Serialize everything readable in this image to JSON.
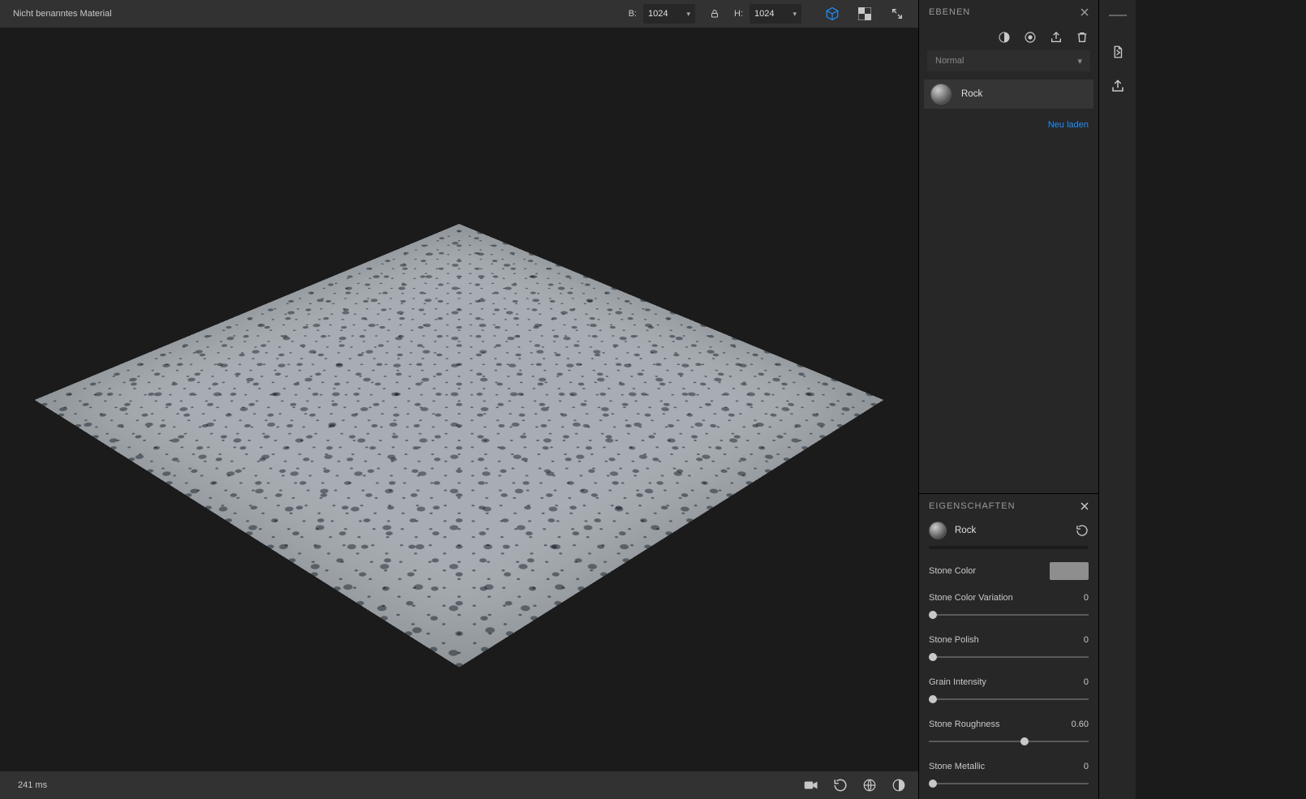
{
  "topbar": {
    "title": "Nicht benanntes Material",
    "dim_b_label": "B:",
    "dim_b_value": "1024",
    "dim_h_label": "H:",
    "dim_h_value": "1024"
  },
  "statusbar": {
    "time": "241 ms"
  },
  "layers_panel": {
    "title": "EBENEN",
    "blend_mode": "Normal",
    "layer_name": "Rock",
    "reload_label": "Neu laden"
  },
  "properties_panel": {
    "title": "EIGENSCHAFTEN",
    "material_name": "Rock",
    "props": {
      "stone_color": {
        "label": "Stone Color"
      },
      "stone_color_variation": {
        "label": "Stone Color Variation",
        "value": "0",
        "pct": 0
      },
      "stone_polish": {
        "label": "Stone Polish",
        "value": "0",
        "pct": 0
      },
      "grain_intensity": {
        "label": "Grain Intensity",
        "value": "0",
        "pct": 0
      },
      "stone_roughness": {
        "label": "Stone Roughness",
        "value": "0.60",
        "pct": 60
      },
      "stone_metallic": {
        "label": "Stone Metallic",
        "value": "0",
        "pct": 0
      }
    }
  }
}
